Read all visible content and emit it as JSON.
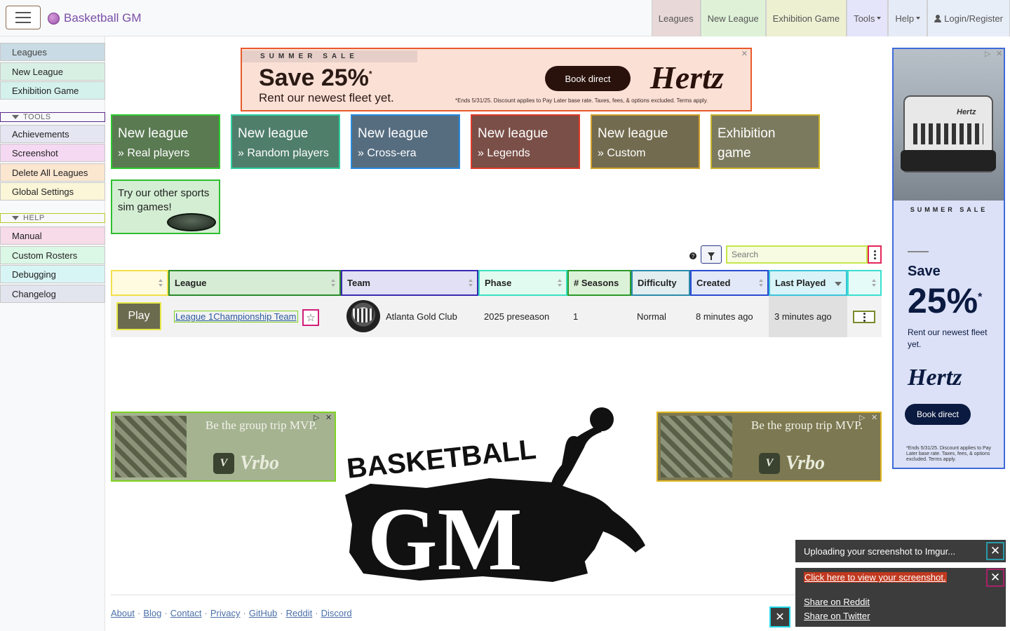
{
  "navbar": {
    "brand": "Basketball GM",
    "items": [
      {
        "label": "Leagues"
      },
      {
        "label": "New League"
      },
      {
        "label": "Exhibition Game"
      },
      {
        "label": "Tools"
      },
      {
        "label": "Help"
      },
      {
        "label": "Login/Register"
      }
    ]
  },
  "sidebar": {
    "items": [
      "Leagues",
      "New League",
      "Exhibition Game"
    ],
    "tools_heading": "TOOLS",
    "tools": [
      "Achievements",
      "Screenshot",
      "Delete All Leagues",
      "Global Settings"
    ],
    "help_heading": "HELP",
    "help": [
      "Manual",
      "Custom Rosters",
      "Debugging",
      "Changelog"
    ]
  },
  "ad_banner": {
    "sale": "SUMMER SALE",
    "headline": "Save 25%",
    "headline_mark": "*",
    "sub": "Rent our newest fleet yet.",
    "button": "Book direct",
    "logo": "Hertz",
    "fine": "*Ends 5/31/25. Discount applies to Pay Later base rate. Taxes, fees, & options excluded. Terms apply."
  },
  "ad_side": {
    "sale": "SUMMER SALE",
    "save": "Save",
    "pct": "25%",
    "pct_mark": "*",
    "rent": "Rent our newest fleet yet.",
    "logo": "Hertz",
    "button": "Book direct",
    "fine": "*Ends 5/31/25. Discount applies to Pay Later base rate. Taxes, fees, & options excluded. Terms apply.",
    "car_badge": "Hertz"
  },
  "ad_vrbo": {
    "text": "Be the group trip MVP.",
    "logo": "Vrbo",
    "mark": "V"
  },
  "tiles": [
    {
      "l1": "New league",
      "l2": "» Real players",
      "color": "#5a7a52"
    },
    {
      "l1": "New league",
      "l2": "» Random players",
      "color": "#4f7e6a"
    },
    {
      "l1": "New league",
      "l2": "» Cross-era",
      "color": "#566d80"
    },
    {
      "l1": "New league",
      "l2": "» Legends",
      "color": "#7a4f47"
    },
    {
      "l1": "New league",
      "l2": "» Custom",
      "color": "#736b4f"
    },
    {
      "l1": "Exhibition",
      "l2": "game",
      "color": "#7c7a5e"
    }
  ],
  "other_sports": "Try our other sports sim games!",
  "table": {
    "search_placeholder": "Search",
    "help_mark": "?",
    "headers": [
      "",
      "League",
      "Team",
      "Phase",
      "# Seasons",
      "Difficulty",
      "Created",
      "Last Played",
      ""
    ],
    "row": {
      "play": "Play",
      "league": "League 1Championship Team",
      "star": "☆",
      "team": "Atlanta Gold Club",
      "phase": "2025 preseason",
      "seasons": "1",
      "difficulty": "Normal",
      "created": "8 minutes ago",
      "last_played": "3 minutes ago"
    }
  },
  "big_logo": {
    "top": "BASKETBALL",
    "bottom": "GM"
  },
  "footer": {
    "links": [
      "About",
      "Blog",
      "Contact",
      "Privacy",
      "GitHub",
      "Reddit",
      "Discord"
    ],
    "sep": "·"
  },
  "toasts": {
    "uploading": "Uploading your screenshot to Imgur...",
    "view": "Click here to view your screenshot.",
    "reddit": "Share on Reddit",
    "twitter": "Share on Twitter",
    "close": "✕"
  },
  "ad_close": "✕",
  "ad_choices": "▷"
}
